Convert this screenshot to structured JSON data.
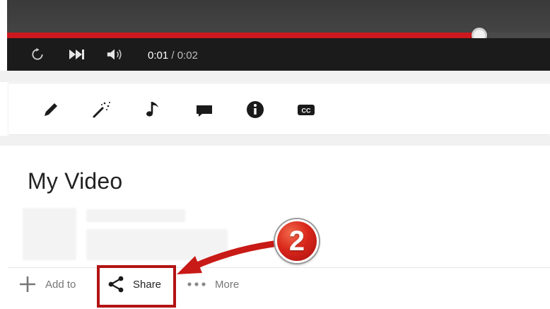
{
  "player": {
    "time_current": "0:01",
    "time_separator": " / ",
    "time_duration": "0:02",
    "progress_fraction": 0.87,
    "accent_color": "#cc181e",
    "controls": [
      "replay-icon",
      "next-icon",
      "volume-icon"
    ]
  },
  "editor_toolbar": {
    "icons": [
      "pencil-icon",
      "magic-wand-icon",
      "music-note-icon",
      "comment-icon",
      "info-icon",
      "closed-captions-icon"
    ]
  },
  "video": {
    "title": "My Video"
  },
  "actions": {
    "add_to_label": "Add to",
    "share_label": "Share",
    "more_label": "More"
  },
  "annotation": {
    "step_number": "2",
    "highlight_color": "#b31313"
  }
}
